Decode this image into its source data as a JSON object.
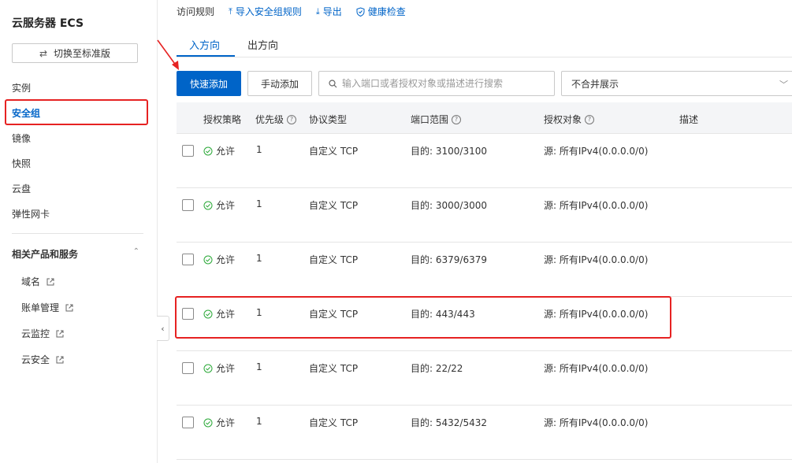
{
  "sidebar": {
    "app_title": "云服务器 ECS",
    "switch_button": "切换至标准版",
    "items": [
      {
        "label": "实例"
      },
      {
        "label": "安全组"
      },
      {
        "label": "镜像"
      },
      {
        "label": "快照"
      },
      {
        "label": "云盘"
      },
      {
        "label": "弹性网卡"
      }
    ],
    "section_title": "相关产品和服务",
    "sub_items": [
      {
        "label": "域名"
      },
      {
        "label": "账单管理"
      },
      {
        "label": "云监控"
      },
      {
        "label": "云安全"
      }
    ]
  },
  "topbar": {
    "title": "访问规则",
    "import_label": "导入安全组规则",
    "export_label": "导出",
    "health_label": "健康检查"
  },
  "tabs": {
    "inbound": "入方向",
    "outbound": "出方向"
  },
  "toolbar": {
    "quick_add": "快速添加",
    "manual_add": "手动添加",
    "search_placeholder": "输入端口或者授权对象或描述进行搜索",
    "select_value": "不合并展示"
  },
  "table": {
    "columns": [
      "授权策略",
      "优先级",
      "协议类型",
      "端口范围",
      "授权对象",
      "描述"
    ],
    "rows": [
      {
        "policy": "允许",
        "priority": "1",
        "protocol": "自定义 TCP",
        "port": "目的: 3100/3100",
        "source": "源: 所有IPv4(0.0.0.0/0)"
      },
      {
        "policy": "允许",
        "priority": "1",
        "protocol": "自定义 TCP",
        "port": "目的: 3000/3000",
        "source": "源: 所有IPv4(0.0.0.0/0)"
      },
      {
        "policy": "允许",
        "priority": "1",
        "protocol": "自定义 TCP",
        "port": "目的: 6379/6379",
        "source": "源: 所有IPv4(0.0.0.0/0)"
      },
      {
        "policy": "允许",
        "priority": "1",
        "protocol": "自定义 TCP",
        "port": "目的: 443/443",
        "source": "源: 所有IPv4(0.0.0.0/0)"
      },
      {
        "policy": "允许",
        "priority": "1",
        "protocol": "自定义 TCP",
        "port": "目的: 22/22",
        "source": "源: 所有IPv4(0.0.0.0/0)"
      },
      {
        "policy": "允许",
        "priority": "1",
        "protocol": "自定义 TCP",
        "port": "目的: 5432/5432",
        "source": "源: 所有IPv4(0.0.0.0/0)"
      }
    ]
  },
  "colors": {
    "primary": "#0064c8",
    "highlight": "#e62222",
    "allow_green": "#2aa837"
  }
}
